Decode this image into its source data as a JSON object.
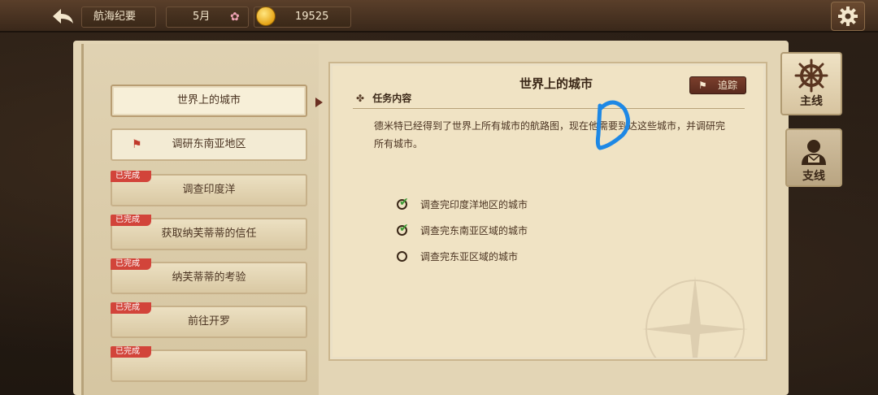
{
  "topbar": {
    "title": "航海纪要",
    "month": "5月",
    "coins": "19525"
  },
  "quest_list": {
    "items": [
      {
        "label": "世界上的城市",
        "state": "selected",
        "badge": ""
      },
      {
        "label": "调研东南亚地区",
        "state": "active",
        "badge": ""
      },
      {
        "label": "调查印度洋",
        "state": "done",
        "badge": "已完成"
      },
      {
        "label": "获取纳芙蒂蒂的信任",
        "state": "done",
        "badge": "已完成"
      },
      {
        "label": "纳芙蒂蒂的考验",
        "state": "done",
        "badge": "已完成"
      },
      {
        "label": "前往开罗",
        "state": "done",
        "badge": "已完成"
      },
      {
        "label": "",
        "state": "done",
        "badge": "已完成"
      }
    ]
  },
  "quest_detail": {
    "title": "世界上的城市",
    "track_label": "追踪",
    "section_title": "任务内容",
    "description": "德米特已经得到了世界上所有城市的航路图，现在他需要到达这些城市，并调研完所有城市。",
    "tasks": [
      {
        "label": "调查完印度洋地区的城市",
        "done": true
      },
      {
        "label": "调查完东南亚区域的城市",
        "done": true
      },
      {
        "label": "调查完东亚区域的城市",
        "done": false
      }
    ]
  },
  "side_tabs": {
    "main": "主线",
    "branch": "支线"
  },
  "colors": {
    "badge": "#d2443a",
    "check": "#3c9b34",
    "pen_mark": "#1e88e5"
  }
}
